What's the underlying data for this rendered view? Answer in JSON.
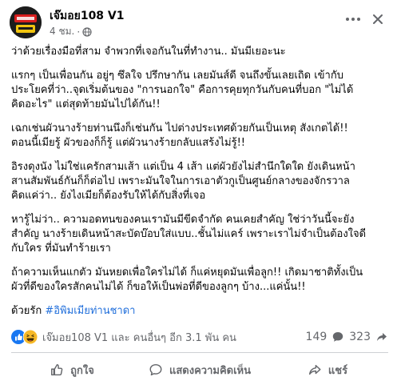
{
  "post": {
    "author": "เจ๊มอย108 V1",
    "time": "4 ชม.",
    "privacy_icon": "globe-icon",
    "paragraphs": [
      "ว่าด้วยเรื่องมือที่สาม จำพวกที่เจอกันในที่ทำงาน.. มันมีเยอะนะ",
      "แรกๆ เป็นเพื่อนกัน อยู่ๆ ซึลใจ ปรึกษากัน เลยมันส์ดี จนถึงขั้นเลยเถิด เข้ากับ\nประโยคที่ว่า..จุดเริ่มต้นของ \"การนอกใจ\" คือการคุยทุกวันกับคนที่บอก \"ไม่ได้\nคิดอะไร\" แต่สุดท้ายมันไปได้กัน!!",
      "เฉกเช่นผัวนางร้ายท่านนึงก็เช่นกัน ไปต่างประเทศด้วยกันเป็นเหตุ สังเกตได้!!\nตอนนี้เมียรู้ ผัวของก็ก็รู้ แต่ผัวนางร้ายกลับแสร้งไม่รู้!!",
      "อิรงดุงนัง ไม่ใช่แครักสามเส้า แต่เป็น 4 เส้า แต่ผัวยังไม่สำนึกใดใด ยังเดินหน้า\nสานสัมพันธ์กันก็ก็ต่อไป เพราะมันใจในการเอาตัวกูเป็นศูนย์กลางของจักรวาล\nคิดแค่ว่า.. ยังไงเมียก็ต้องรับให้ได้กับสิ่งที่เจอ",
      "หารู้ไม่ว่า.. ความอดทนของคนเรามันมีขีดจำกัด คนเคยสำคัญ ใช่ว่าวันนี้จะยัง\nสำคัญ นางร้ายเดินหน้าสะบัดบ๊อบใส่แบบ..ชั้นไม่แคร์ เพราะเราไม่จำเป็นต้องใจดี\nกับใคร ที่มันทำร้ายเรา",
      "ถ้าความเห็นแกตัว มันหยดเพื่อใครไม่ได้ ก็แค่หยุดมันเพื่อลูก!! เกิดมาชาติทั้งเป็น\nผัวที่ดีของใครสักคนไม่ได้ ก็ขอให้เป็นพ่อที่ดีของลูกๆ บ้าง...แค่นั้น!!"
    ],
    "closing_prefix": "ด้วยรัก ",
    "hashtag": "#อิพิมเมียท่านชาดา"
  },
  "reactions": {
    "icons": [
      "like-icon",
      "haha-icon"
    ],
    "summary": "เจ๊มอย108 V1 และ คนอื่นๆ อีก 3.1 พัน คน",
    "comments_count": "149",
    "shares_count": "323"
  },
  "actions": {
    "like_label": "ถูกใจ",
    "comment_label": "แสดงความคิดเห็น",
    "share_label": "แชร์"
  },
  "colors": {
    "primary_text": "#050505",
    "secondary_text": "#65676b",
    "hashtag": "#216fdb",
    "like_blue": "#1877f2",
    "haha_yellow": "#f7b928"
  }
}
